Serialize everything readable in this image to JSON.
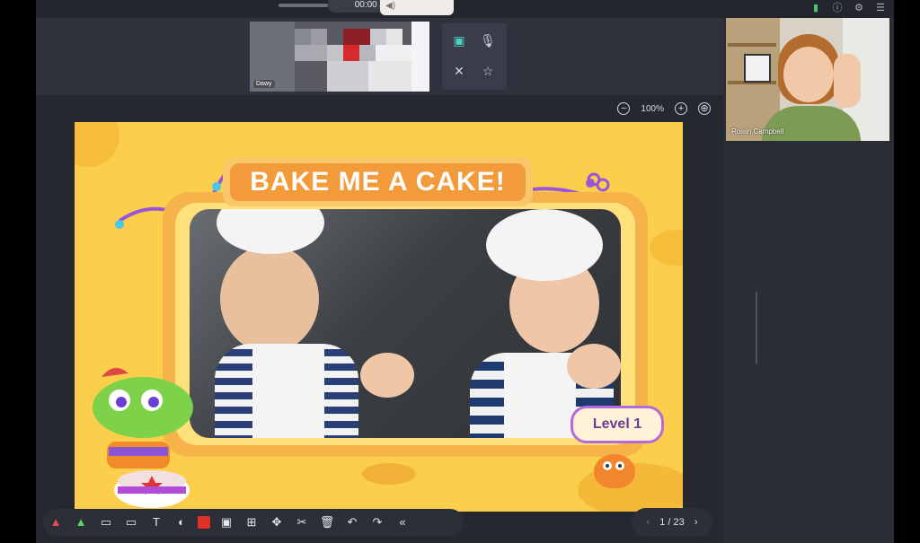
{
  "player": {
    "time": "00:00 /"
  },
  "student": {
    "name": "Dawy"
  },
  "zoom": {
    "level": "100%"
  },
  "slide": {
    "title": "BAKE ME A CAKE!",
    "level_label": "Level 1"
  },
  "pager": {
    "current": "1",
    "total": "23",
    "text": "1 / 23"
  },
  "teacher": {
    "name": "Roisin Campbell"
  },
  "icons": [
    "volume-icon",
    "signal-icon",
    "info-icon",
    "settings-icon",
    "menu-icon",
    "screen-share-icon",
    "microphone-icon",
    "magic-wand-icon",
    "star-icon",
    "zoom-out-icon",
    "zoom-in-icon",
    "fit-screen-icon",
    "pen-icon",
    "marker-icon",
    "eraser-icon",
    "clear-icon",
    "text-icon",
    "shape-icon",
    "color-icon",
    "image-icon",
    "add-icon",
    "move-icon",
    "scissors-icon",
    "trash-icon",
    "undo-icon",
    "redo-icon",
    "collapse-icon",
    "prev-page-icon",
    "next-page-icon"
  ]
}
